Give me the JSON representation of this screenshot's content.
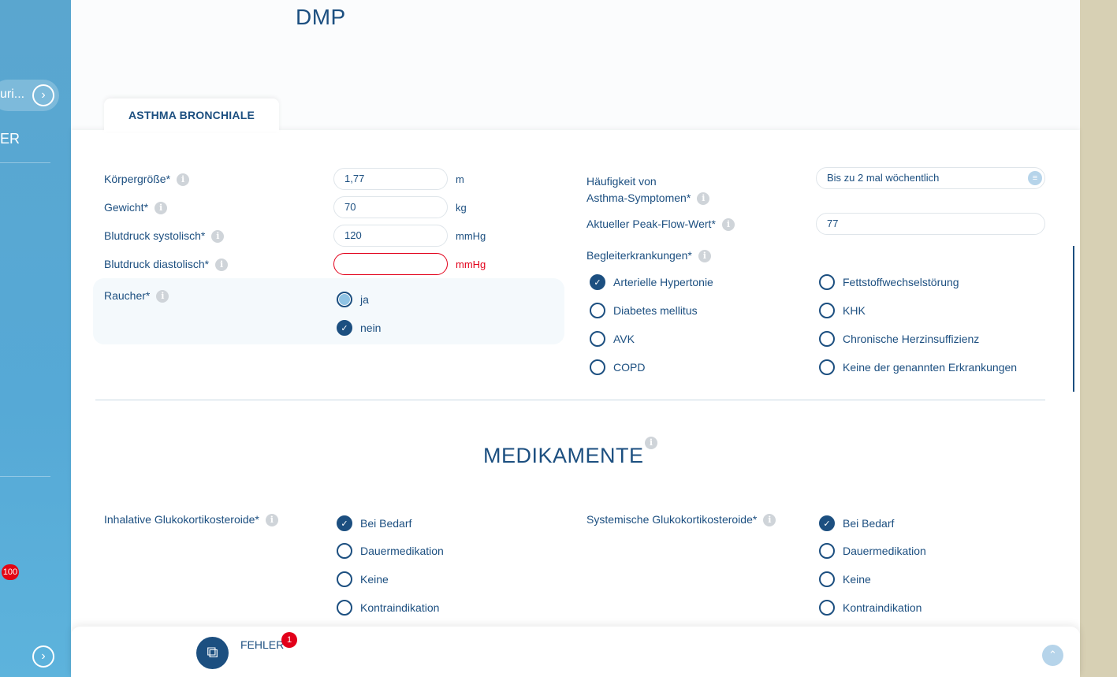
{
  "sidebar": {
    "pill_text": "uri...",
    "section_text": "ER",
    "badge": "100",
    "nav_arrow": "›",
    "bottom_arrow": "›"
  },
  "page": {
    "title": "DMP"
  },
  "tab": {
    "label": "ASTHMA BRONCHIALE"
  },
  "info_glyph": "i",
  "vitals": {
    "height": {
      "label": "Körpergröße*",
      "value": "1,77",
      "unit": "m"
    },
    "weight": {
      "label": "Gewicht*",
      "value": "70",
      "unit": "kg"
    },
    "systolic": {
      "label": "Blutdruck systolisch*",
      "value": "120",
      "unit": "mmHg"
    },
    "diastolic": {
      "label": "Blutdruck diastolisch*",
      "value": "",
      "unit": "mmHg"
    }
  },
  "smoker": {
    "label": "Raucher*",
    "options": [
      {
        "label": "ja",
        "state": "radio-selected"
      },
      {
        "label": "nein",
        "state": "checked"
      }
    ]
  },
  "symptoms": {
    "label_line1": "Häufigkeit von",
    "label_line2": "Asthma-Symptomen*",
    "value": "Bis zu 2 mal wöchentlich",
    "select_icon": "≡"
  },
  "peak_flow": {
    "label": "Aktueller Peak-Flow-Wert*",
    "value": "77"
  },
  "comorbidities": {
    "label": "Begleiterkrankungen*",
    "col1": [
      {
        "label": "Arterielle Hypertonie",
        "checked": true
      },
      {
        "label": "Diabetes mellitus",
        "checked": false
      },
      {
        "label": "AVK",
        "checked": false
      },
      {
        "label": "COPD",
        "checked": false
      }
    ],
    "col2": [
      {
        "label": "Fettstoffwechselstörung",
        "checked": false
      },
      {
        "label": "KHK",
        "checked": false
      },
      {
        "label": "Chronische Herzinsuffizienz",
        "checked": false
      },
      {
        "label": "Keine der genannten Erkrankungen",
        "checked": false
      }
    ]
  },
  "medication": {
    "title": "MEDIKAMENTE",
    "inhaled": {
      "label": "Inhalative Glukokortikosteroide*",
      "options": [
        {
          "label": "Bei Bedarf",
          "checked": true
        },
        {
          "label": "Dauermedikation",
          "checked": false
        },
        {
          "label": "Keine",
          "checked": false
        },
        {
          "label": "Kontraindikation",
          "checked": false
        }
      ]
    },
    "systemic": {
      "label": "Systemische Glukokortikosteroide*",
      "options": [
        {
          "label": "Bei Bedarf",
          "checked": true
        },
        {
          "label": "Dauermedikation",
          "checked": false
        },
        {
          "label": "Keine",
          "checked": false
        },
        {
          "label": "Kontraindikation",
          "checked": false
        }
      ]
    }
  },
  "bottom_bar": {
    "errors_label": "FEHLER",
    "errors_count": "1",
    "errors_icon": "⧉",
    "scroll_top_icon": "⌃"
  },
  "check_glyph": "✓"
}
